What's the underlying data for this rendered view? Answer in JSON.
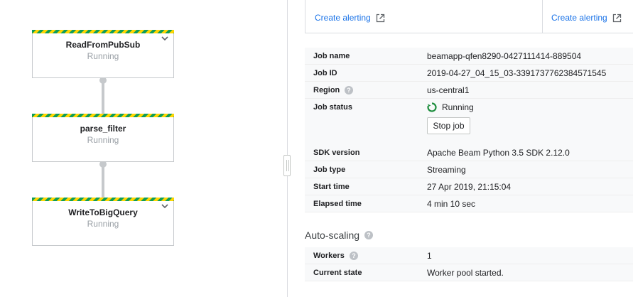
{
  "graph": {
    "steps": [
      {
        "name": "ReadFromPubSub",
        "status": "Running",
        "has_chevron": true
      },
      {
        "name": "parse_filter",
        "status": "Running",
        "has_chevron": false
      },
      {
        "name": "WriteToBigQuery",
        "status": "Running",
        "has_chevron": true
      }
    ],
    "status_colors": {
      "stripe_primary": "#0f9d58",
      "stripe_secondary": "#ffd600"
    }
  },
  "alerting": {
    "left_link": "Create alerting",
    "right_link": "Create alerting"
  },
  "job_info": {
    "job_name_label": "Job name",
    "job_name": "beamapp-qfen8290-0427111414-889504",
    "job_id_label": "Job ID",
    "job_id": "2019-04-27_04_15_03-3391737762384571545",
    "region_label": "Region",
    "region": "us-central1",
    "job_status_label": "Job status",
    "job_status": "Running",
    "stop_button": "Stop job"
  },
  "sdk_info": {
    "sdk_version_label": "SDK version",
    "sdk_version": "Apache Beam Python 3.5 SDK 2.12.0",
    "job_type_label": "Job type",
    "job_type": "Streaming",
    "start_time_label": "Start time",
    "start_time": "27 Apr 2019, 21:15:04",
    "elapsed_time_label": "Elapsed time",
    "elapsed_time": "4 min 10 sec"
  },
  "autoscaling": {
    "title": "Auto-scaling",
    "workers_label": "Workers",
    "workers": "1",
    "current_state_label": "Current state",
    "current_state": "Worker pool started."
  },
  "colors": {
    "link": "#1a73e8",
    "running": "#1e8e3e",
    "help_icon": "#bdc1c6"
  }
}
